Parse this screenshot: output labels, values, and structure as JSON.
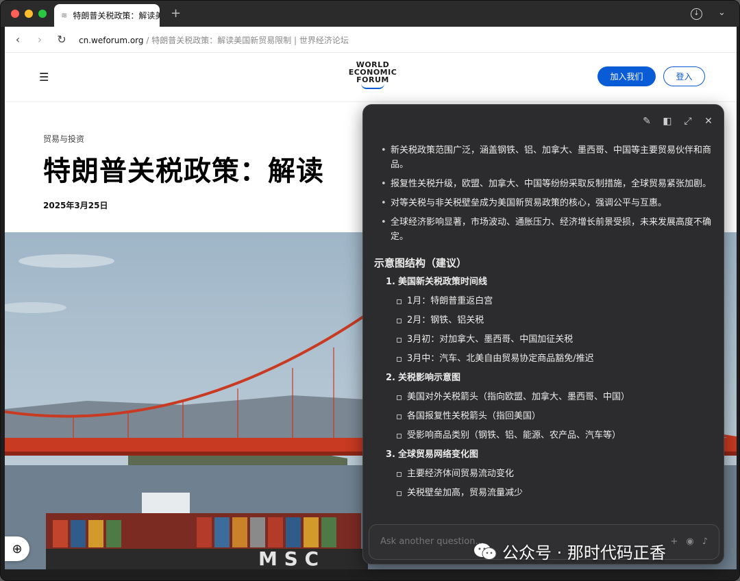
{
  "tab": {
    "title": "特朗普关税政策：解读美",
    "new_tab": "+"
  },
  "address": {
    "host": "cn.weforum.org",
    "rest": " / 特朗普关税政策：解读美国新贸易限制 | 世界经济论坛"
  },
  "site": {
    "logo": [
      "WORLD",
      "ECONOMIC",
      "FORUM"
    ],
    "join_label": "加入我们",
    "login_label": "登入"
  },
  "article": {
    "category": "贸易与投资",
    "headline": "特朗普关税政策：解读",
    "date": "2025年3月25日"
  },
  "panel": {
    "bullets": [
      "新关税政策范围广泛，涵盖钢铁、铝、加拿大、墨西哥、中国等主要贸易伙伴和商品。",
      "报复性关税升级，欧盟、加拿大、中国等纷纷采取反制措施，全球贸易紧张加剧。",
      "对等关税与非关税壁垒成为美国新贸易政策的核心，强调公平与互惠。",
      "全球经济影响显著，市场波动、通胀压力、经济增长前景受损，未来发展高度不确定。"
    ],
    "section_title": "示意图结构（建议）",
    "items": [
      {
        "num": "1.",
        "title": "美国新关税政策时间线",
        "subs": [
          "1月：特朗普重返白宫",
          "2月：钢铁、铝关税",
          "3月初：对加拿大、墨西哥、中国加征关税",
          "3月中：汽车、北美自由贸易协定商品豁免/推迟"
        ]
      },
      {
        "num": "2.",
        "title": "关税影响示意图",
        "subs": [
          "美国对外关税箭头（指向欧盟、加拿大、墨西哥、中国）",
          "各国报复性关税箭头（指回美国）",
          "受影响商品类别（钢铁、铝、能源、农产品、汽车等）"
        ]
      },
      {
        "num": "3.",
        "title": "全球贸易网络变化图",
        "subs": [
          "主要经济体间贸易流动变化",
          "关税壁垒加高，贸易流量减少"
        ]
      }
    ],
    "ask_placeholder": "Ask another question..."
  },
  "watermark": "公众号 · 那时代码正香",
  "hero_text": "M S C"
}
